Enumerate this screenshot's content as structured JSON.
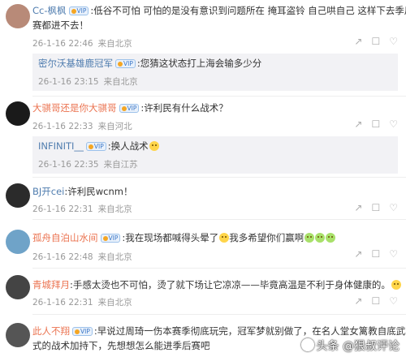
{
  "comments": [
    {
      "user": "Cc-枫枫",
      "vip": "VIP",
      "text1": ":低谷不可怕 可怕的是没有意识到问题所在 掩耳盗铃 自己哄自己 这样下去季后",
      "text2": "赛都进不去！",
      "time": "26-1-16 22:46",
      "location": "来自北京",
      "avatar_color": "#b88a78",
      "reply": {
        "user": "密尔沃基雄鹿冠军",
        "vip": "VIP",
        "text": ":您猜这状态打上海会输多少分",
        "time": "26-1-16 23:15",
        "location": "来自北京"
      }
    },
    {
      "user": "大骐哥还是你大骐哥",
      "vip": "VIP",
      "text1": ":许利民有什么战术？",
      "time": "26-1-16 22:33",
      "location": "来自河北",
      "avatar_color": "#1a1a1a",
      "reply": {
        "user": "INFINITI__",
        "vip": "VIP",
        "text": ":换人战术",
        "time": "26-1-16 22:35",
        "location": "来自江苏"
      }
    },
    {
      "user": "BJ开cei",
      "text1": ":许利民wcnm！",
      "time": "26-1-16 22:31",
      "location": "来自北京",
      "avatar_color": "#2b2b2b"
    },
    {
      "user": "孤舟自泊山水间",
      "vip": "VIP",
      "text1": ":我在现场都喊得头晕了",
      "text1b": "我多希望你们赢啊",
      "time": "26-1-16 22:48",
      "location": "来自北京",
      "avatar_color": "#6fa3c8"
    },
    {
      "user": "青城拜月",
      "text1": ":手感太烫也不可怕，烫了就下场让它凉凉——毕竟高温是不利于身体健康的。",
      "time": "26-1-16 22:31",
      "location": "来自北京",
      "avatar_color": "#444"
    },
    {
      "user": "此人不翔",
      "vip": "VIP",
      "text1": ":早说过周琦一伤本赛季彻底玩完，冠军梦就别做了，在名人堂女篱教自底武功",
      "text2": "式的战术加持下，先想想怎么能进季后赛吧",
      "avatar_color": "#555"
    }
  ],
  "actions": {
    "share": "↗",
    "comment": "☐",
    "like": "♡"
  },
  "watermark": "头条 @狠叔评论"
}
